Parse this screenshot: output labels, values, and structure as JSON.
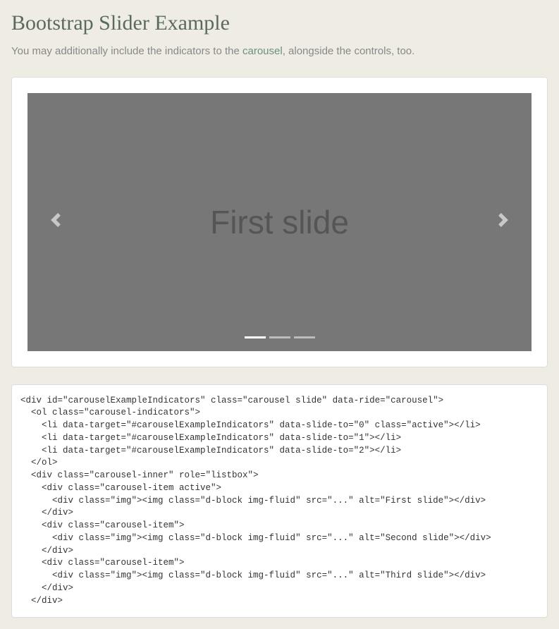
{
  "page": {
    "title": "Bootstrap Slider Example",
    "intro_before": "You may additionally include the indicators to the ",
    "intro_link": "carousel",
    "intro_after": ", alongside the controls, too."
  },
  "carousel": {
    "current_slide_text": "First slide",
    "indicators": [
      "0",
      "1",
      "2"
    ],
    "active_indicator": 0
  },
  "code": "<div id=\"carouselExampleIndicators\" class=\"carousel slide\" data-ride=\"carousel\">\n  <ol class=\"carousel-indicators\">\n    <li data-target=\"#carouselExampleIndicators\" data-slide-to=\"0\" class=\"active\"></li>\n    <li data-target=\"#carouselExampleIndicators\" data-slide-to=\"1\"></li>\n    <li data-target=\"#carouselExampleIndicators\" data-slide-to=\"2\"></li>\n  </ol>\n  <div class=\"carousel-inner\" role=\"listbox\">\n    <div class=\"carousel-item active\">\n      <div class=\"img\"><img class=\"d-block img-fluid\" src=\"...\" alt=\"First slide\"></div>\n    </div>\n    <div class=\"carousel-item\">\n      <div class=\"img\"><img class=\"d-block img-fluid\" src=\"...\" alt=\"Second slide\"></div>\n    </div>\n    <div class=\"carousel-item\">\n      <div class=\"img\"><img class=\"d-block img-fluid\" src=\"...\" alt=\"Third slide\"></div>\n    </div>\n  </div>"
}
